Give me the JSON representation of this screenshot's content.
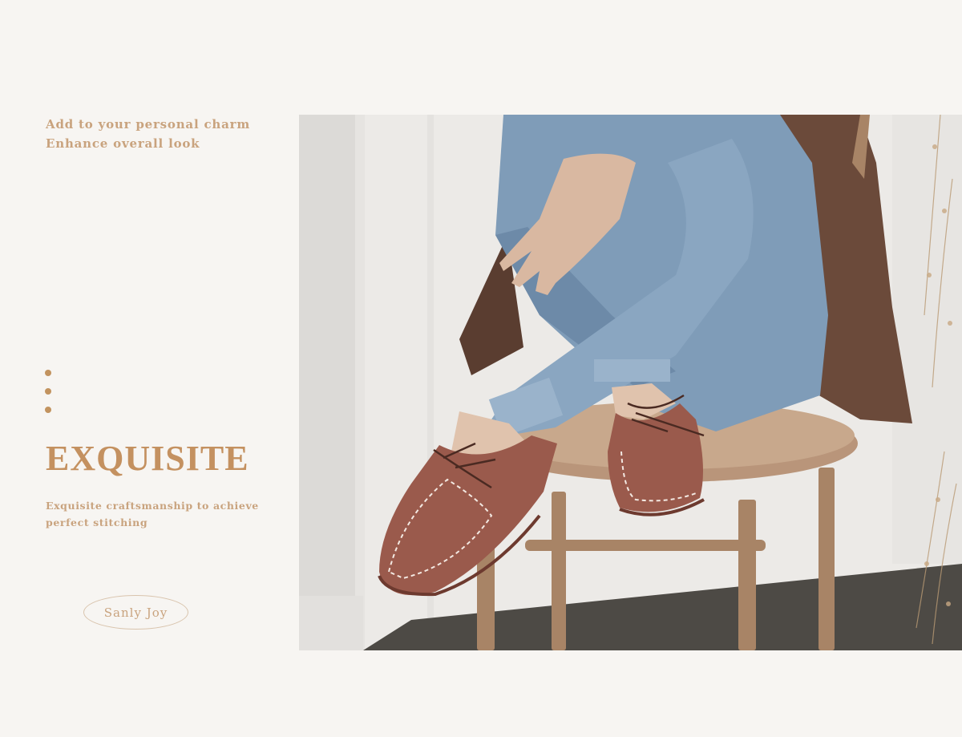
{
  "tagline": {
    "line1": "Add to your personal charm",
    "line2": "Enhance overall look"
  },
  "headline": "EXQUISITE",
  "description": "Exquisite craftsmanship to achieve perfect stitching",
  "brand": "Sanly Joy",
  "colors": {
    "background": "#f7f5f2",
    "accent": "#c49160",
    "text_light": "#c9a37e",
    "shoe": "#9a5a4c",
    "denim": "#7f9cb8",
    "chair": "#a88466",
    "jacket": "#6b4a3a"
  }
}
